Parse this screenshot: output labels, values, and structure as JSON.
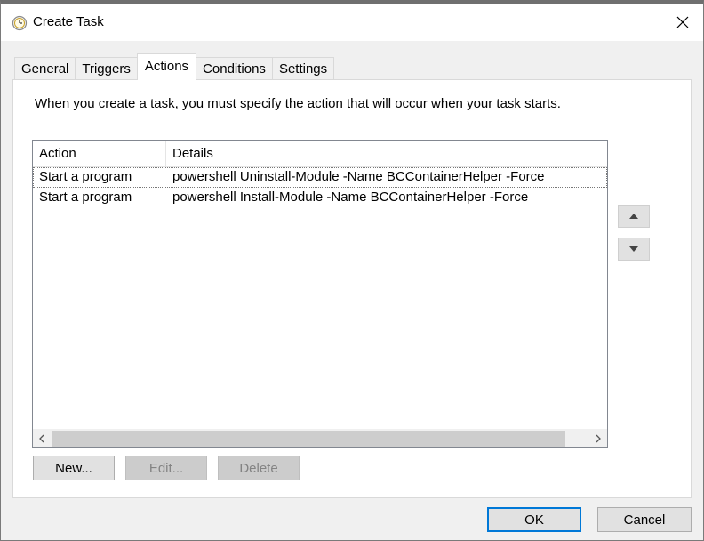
{
  "window": {
    "title": "Create Task",
    "icon": "clock-icon",
    "close_icon": "close-icon"
  },
  "tabs": [
    {
      "label": "General",
      "active": false
    },
    {
      "label": "Triggers",
      "active": false
    },
    {
      "label": "Actions",
      "active": true
    },
    {
      "label": "Conditions",
      "active": false
    },
    {
      "label": "Settings",
      "active": false
    }
  ],
  "actions_panel": {
    "intro": "When you create a task, you must specify the action that will occur when your task starts.",
    "columns": [
      "Action",
      "Details"
    ],
    "rows": [
      {
        "action": "Start a program",
        "details": "powershell Uninstall-Module -Name BCContainerHelper -Force"
      },
      {
        "action": "Start a program",
        "details": "powershell Install-Module -Name BCContainerHelper -Force"
      }
    ],
    "buttons": {
      "new": "New...",
      "edit": "Edit...",
      "delete": "Delete"
    },
    "move_up_icon": "triangle-up-icon",
    "move_down_icon": "triangle-down-icon",
    "scroll_left_icon": "chevron-left-icon",
    "scroll_right_icon": "chevron-right-icon"
  },
  "footer": {
    "ok": "OK",
    "cancel": "Cancel"
  },
  "colors": {
    "accent": "#0078d7",
    "background": "#f0f0f0",
    "panel": "#ffffff"
  }
}
